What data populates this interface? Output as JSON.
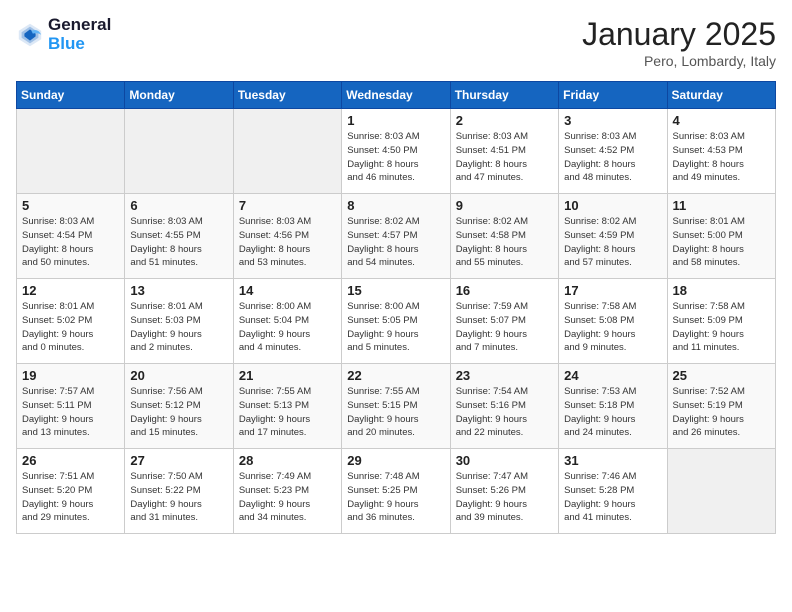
{
  "logo": {
    "line1": "General",
    "line2": "Blue"
  },
  "title": "January 2025",
  "location": "Pero, Lombardy, Italy",
  "days_of_week": [
    "Sunday",
    "Monday",
    "Tuesday",
    "Wednesday",
    "Thursday",
    "Friday",
    "Saturday"
  ],
  "weeks": [
    [
      {
        "day": "",
        "info": ""
      },
      {
        "day": "",
        "info": ""
      },
      {
        "day": "",
        "info": ""
      },
      {
        "day": "1",
        "info": "Sunrise: 8:03 AM\nSunset: 4:50 PM\nDaylight: 8 hours\nand 46 minutes."
      },
      {
        "day": "2",
        "info": "Sunrise: 8:03 AM\nSunset: 4:51 PM\nDaylight: 8 hours\nand 47 minutes."
      },
      {
        "day": "3",
        "info": "Sunrise: 8:03 AM\nSunset: 4:52 PM\nDaylight: 8 hours\nand 48 minutes."
      },
      {
        "day": "4",
        "info": "Sunrise: 8:03 AM\nSunset: 4:53 PM\nDaylight: 8 hours\nand 49 minutes."
      }
    ],
    [
      {
        "day": "5",
        "info": "Sunrise: 8:03 AM\nSunset: 4:54 PM\nDaylight: 8 hours\nand 50 minutes."
      },
      {
        "day": "6",
        "info": "Sunrise: 8:03 AM\nSunset: 4:55 PM\nDaylight: 8 hours\nand 51 minutes."
      },
      {
        "day": "7",
        "info": "Sunrise: 8:03 AM\nSunset: 4:56 PM\nDaylight: 8 hours\nand 53 minutes."
      },
      {
        "day": "8",
        "info": "Sunrise: 8:02 AM\nSunset: 4:57 PM\nDaylight: 8 hours\nand 54 minutes."
      },
      {
        "day": "9",
        "info": "Sunrise: 8:02 AM\nSunset: 4:58 PM\nDaylight: 8 hours\nand 55 minutes."
      },
      {
        "day": "10",
        "info": "Sunrise: 8:02 AM\nSunset: 4:59 PM\nDaylight: 8 hours\nand 57 minutes."
      },
      {
        "day": "11",
        "info": "Sunrise: 8:01 AM\nSunset: 5:00 PM\nDaylight: 8 hours\nand 58 minutes."
      }
    ],
    [
      {
        "day": "12",
        "info": "Sunrise: 8:01 AM\nSunset: 5:02 PM\nDaylight: 9 hours\nand 0 minutes."
      },
      {
        "day": "13",
        "info": "Sunrise: 8:01 AM\nSunset: 5:03 PM\nDaylight: 9 hours\nand 2 minutes."
      },
      {
        "day": "14",
        "info": "Sunrise: 8:00 AM\nSunset: 5:04 PM\nDaylight: 9 hours\nand 4 minutes."
      },
      {
        "day": "15",
        "info": "Sunrise: 8:00 AM\nSunset: 5:05 PM\nDaylight: 9 hours\nand 5 minutes."
      },
      {
        "day": "16",
        "info": "Sunrise: 7:59 AM\nSunset: 5:07 PM\nDaylight: 9 hours\nand 7 minutes."
      },
      {
        "day": "17",
        "info": "Sunrise: 7:58 AM\nSunset: 5:08 PM\nDaylight: 9 hours\nand 9 minutes."
      },
      {
        "day": "18",
        "info": "Sunrise: 7:58 AM\nSunset: 5:09 PM\nDaylight: 9 hours\nand 11 minutes."
      }
    ],
    [
      {
        "day": "19",
        "info": "Sunrise: 7:57 AM\nSunset: 5:11 PM\nDaylight: 9 hours\nand 13 minutes."
      },
      {
        "day": "20",
        "info": "Sunrise: 7:56 AM\nSunset: 5:12 PM\nDaylight: 9 hours\nand 15 minutes."
      },
      {
        "day": "21",
        "info": "Sunrise: 7:55 AM\nSunset: 5:13 PM\nDaylight: 9 hours\nand 17 minutes."
      },
      {
        "day": "22",
        "info": "Sunrise: 7:55 AM\nSunset: 5:15 PM\nDaylight: 9 hours\nand 20 minutes."
      },
      {
        "day": "23",
        "info": "Sunrise: 7:54 AM\nSunset: 5:16 PM\nDaylight: 9 hours\nand 22 minutes."
      },
      {
        "day": "24",
        "info": "Sunrise: 7:53 AM\nSunset: 5:18 PM\nDaylight: 9 hours\nand 24 minutes."
      },
      {
        "day": "25",
        "info": "Sunrise: 7:52 AM\nSunset: 5:19 PM\nDaylight: 9 hours\nand 26 minutes."
      }
    ],
    [
      {
        "day": "26",
        "info": "Sunrise: 7:51 AM\nSunset: 5:20 PM\nDaylight: 9 hours\nand 29 minutes."
      },
      {
        "day": "27",
        "info": "Sunrise: 7:50 AM\nSunset: 5:22 PM\nDaylight: 9 hours\nand 31 minutes."
      },
      {
        "day": "28",
        "info": "Sunrise: 7:49 AM\nSunset: 5:23 PM\nDaylight: 9 hours\nand 34 minutes."
      },
      {
        "day": "29",
        "info": "Sunrise: 7:48 AM\nSunset: 5:25 PM\nDaylight: 9 hours\nand 36 minutes."
      },
      {
        "day": "30",
        "info": "Sunrise: 7:47 AM\nSunset: 5:26 PM\nDaylight: 9 hours\nand 39 minutes."
      },
      {
        "day": "31",
        "info": "Sunrise: 7:46 AM\nSunset: 5:28 PM\nDaylight: 9 hours\nand 41 minutes."
      },
      {
        "day": "",
        "info": ""
      }
    ]
  ]
}
